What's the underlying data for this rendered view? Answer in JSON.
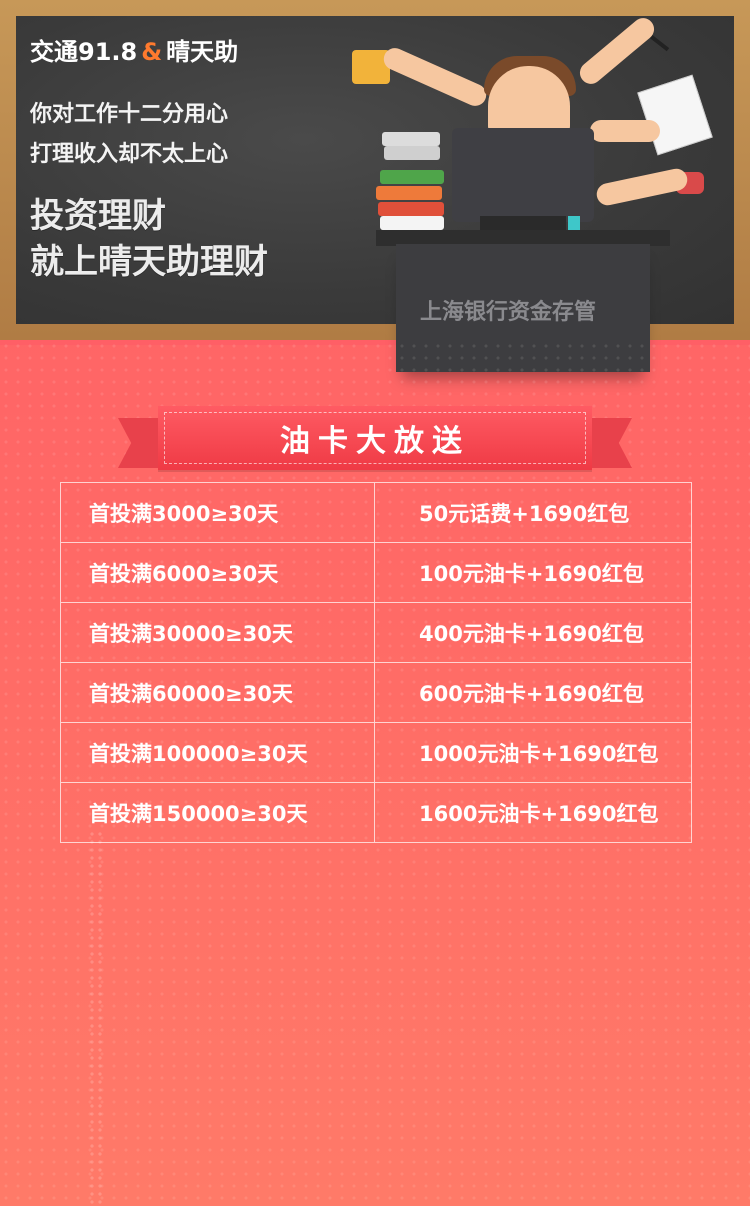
{
  "hero": {
    "brand_part1": "交通91.8",
    "brand_amp": "&",
    "brand_part2": "晴天助",
    "tagline_1": "你对工作十二分用心",
    "tagline_2": "打理收入却不太上心",
    "headline_1": "投资理财",
    "headline_2": "就上晴天助理财",
    "desk_label": "上海银行资金存管"
  },
  "ribbon": {
    "title": "油卡大放送"
  },
  "table": {
    "rows": [
      {
        "condition": "首投满3000≥30天",
        "reward": "50元话费+1690红包"
      },
      {
        "condition": "首投满6000≥30天",
        "reward": "100元油卡+1690红包"
      },
      {
        "condition": "首投满30000≥30天",
        "reward": "400元油卡+1690红包"
      },
      {
        "condition": "首投满60000≥30天",
        "reward": "600元油卡+1690红包"
      },
      {
        "condition": "首投满100000≥30天",
        "reward": "1000元油卡+1690红包"
      },
      {
        "condition": "首投满150000≥30天",
        "reward": "1600元油卡+1690红包"
      }
    ]
  },
  "colors": {
    "background_top": "#ff5f66",
    "background_bottom": "#ff7a68",
    "ribbon": "#ef3a45",
    "brand_accent": "#ff7a2e",
    "board": "#3a3a3a",
    "frame": "#b07c44"
  },
  "icons": [
    "coffee-cup-icon",
    "pencil-icon",
    "paper-icon",
    "phone-icon",
    "books-icon",
    "monitor-icon"
  ]
}
